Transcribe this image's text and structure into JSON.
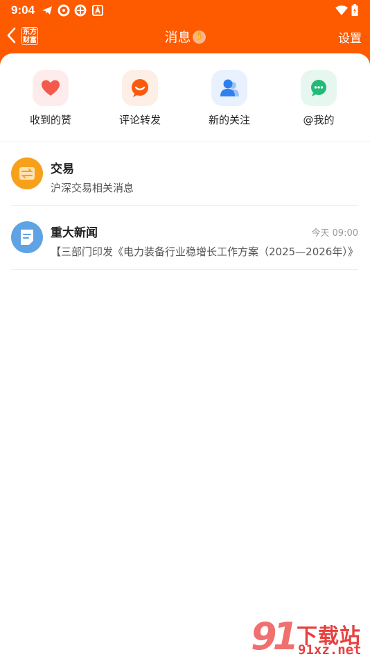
{
  "status_bar": {
    "time": "9:04",
    "icons": [
      "telegram-icon",
      "app-icon",
      "app-icon",
      "a-icon",
      "wifi-icon",
      "battery-icon"
    ]
  },
  "nav": {
    "brand": "东方财富",
    "title": "消息",
    "settings_label": "设置"
  },
  "quick_actions": [
    {
      "label": "收到的赞",
      "icon": "heart-icon",
      "bg": "#fdeceb",
      "color": "#f45a4b"
    },
    {
      "label": "评论转发",
      "icon": "comment-icon",
      "bg": "#fdeee6",
      "color": "#fa5a0e"
    },
    {
      "label": "新的关注",
      "icon": "user-icon",
      "bg": "#e8f1fd",
      "color": "#2f7fef"
    },
    {
      "label": "@我的",
      "icon": "chat-icon",
      "bg": "#e6f7ef",
      "color": "#22ba77"
    }
  ],
  "messages": [
    {
      "title": "交易",
      "subtitle": "沪深交易相关消息",
      "time": "",
      "icon": "exchange-icon",
      "color": "#f7a11a"
    },
    {
      "title": "重大新闻",
      "subtitle": "【三部门印发《电力装备行业稳增长工作方案（2025—2026年）》",
      "time": "今天 09:00",
      "icon": "document-icon",
      "color": "#5fa3e4"
    }
  ],
  "watermark": {
    "cn": "下载站",
    "url": "91xz.net",
    "num": "91"
  },
  "colors": {
    "accent": "#fe5a00"
  }
}
